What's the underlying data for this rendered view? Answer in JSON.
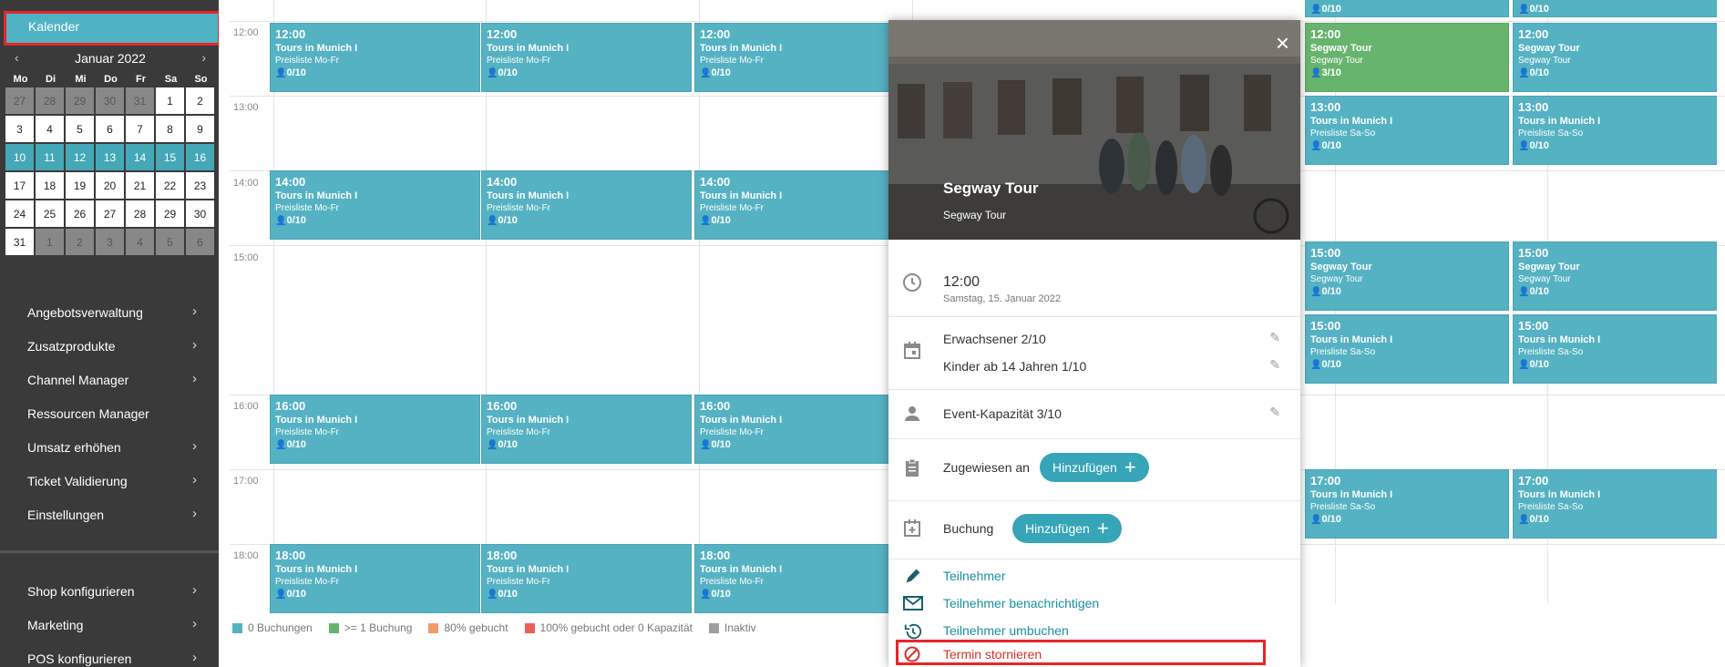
{
  "sidebar": {
    "calendar_label": "Kalender",
    "month": "Januar 2022",
    "prev": "‹",
    "next": "›",
    "weekdays": [
      "Mo",
      "Di",
      "Mi",
      "Do",
      "Fr",
      "Sa",
      "So"
    ],
    "weeks": [
      [
        "27",
        "28",
        "29",
        "30",
        "31",
        "1",
        "2"
      ],
      [
        "3",
        "4",
        "5",
        "6",
        "7",
        "8",
        "9"
      ],
      [
        "10",
        "11",
        "12",
        "13",
        "14",
        "15",
        "16"
      ],
      [
        "17",
        "18",
        "19",
        "20",
        "21",
        "22",
        "23"
      ],
      [
        "24",
        "25",
        "26",
        "27",
        "28",
        "29",
        "30"
      ],
      [
        "31",
        "1",
        "2",
        "3",
        "4",
        "5",
        "6"
      ]
    ],
    "menu_top": [
      {
        "label": "Angebotsverwaltung",
        "chevron": true
      },
      {
        "label": "Zusatzprodukte",
        "chevron": true
      },
      {
        "label": "Channel Manager",
        "chevron": true
      },
      {
        "label": "Ressourcen Manager",
        "chevron": false
      },
      {
        "label": "Umsatz erhöhen",
        "chevron": true
      },
      {
        "label": "Ticket Validierung",
        "chevron": true
      },
      {
        "label": "Einstellungen",
        "chevron": true
      }
    ],
    "menu_bottom": [
      {
        "label": "Shop konfigurieren",
        "chevron": true
      },
      {
        "label": "Marketing",
        "chevron": true
      },
      {
        "label": "POS konfigurieren",
        "chevron": true
      }
    ],
    "chevron_glyph": "›"
  },
  "calendar": {
    "times": [
      "12:00",
      "13:00",
      "14:00",
      "15:00",
      "16:00",
      "17:00",
      "18:00"
    ],
    "top_counts": [
      "0/10",
      "0/10"
    ],
    "weekday_event": {
      "name": "Tours in Munich I",
      "price": "Preisliste Mo-Fr",
      "count": "0/10"
    },
    "weekday_times": [
      "12:00",
      "14:00",
      "16:00",
      "18:00"
    ],
    "weekend_events": [
      {
        "time": "12:00",
        "name": "Segway Tour",
        "price": "Segway Tour",
        "counts": [
          "3/10",
          "0/10"
        ]
      },
      {
        "time": "13:00",
        "name": "Tours in Munich I",
        "price": "Preisliste Sa-So",
        "counts": [
          "0/10",
          "0/10"
        ]
      },
      {
        "time": "15:00",
        "name": "Segway Tour",
        "price": "Segway Tour",
        "counts": [
          "0/10",
          "0/10"
        ]
      },
      {
        "time": "15:00",
        "name": "Tours in Munich I",
        "price": "Preisliste Sa-So",
        "counts": [
          "0/10",
          "0/10"
        ]
      },
      {
        "time": "17:00",
        "name": "Tours in Munich I",
        "price": "Preisliste Sa-So",
        "counts": [
          "0/10",
          "0/10"
        ]
      }
    ],
    "colors": {
      "event": "#55b2c3",
      "booked": "#67b46e"
    }
  },
  "legend": [
    {
      "label": "0 Buchungen",
      "color": "#55b2c3"
    },
    {
      "label": ">= 1 Buchung",
      "color": "#67b46e"
    },
    {
      "label": "80% gebucht",
      "color": "#f39a6b"
    },
    {
      "label": "100% gebucht oder 0 Kapazität",
      "color": "#ef5f5a"
    },
    {
      "label": "Inaktiv",
      "color": "#9e9e9e"
    }
  ],
  "popup": {
    "title": "Segway Tour",
    "subtitle": "Segway Tour",
    "close": "×",
    "time": "12:00",
    "date": "Samstag, 15. Januar 2022",
    "adults": "Erwachsener 2/10",
    "children": "Kinder ab 14 Jahren 1/10",
    "capacity": "Event-Kapazität 3/10",
    "assigned_label": "Zugewiesen an",
    "booking_label": "Buchung",
    "add_label": "Hinzufügen",
    "plus": "+",
    "links": [
      "Teilnehmer",
      "Teilnehmer benachrichtigen",
      "Teilnehmer umbuchen",
      "Termin stornieren"
    ]
  }
}
